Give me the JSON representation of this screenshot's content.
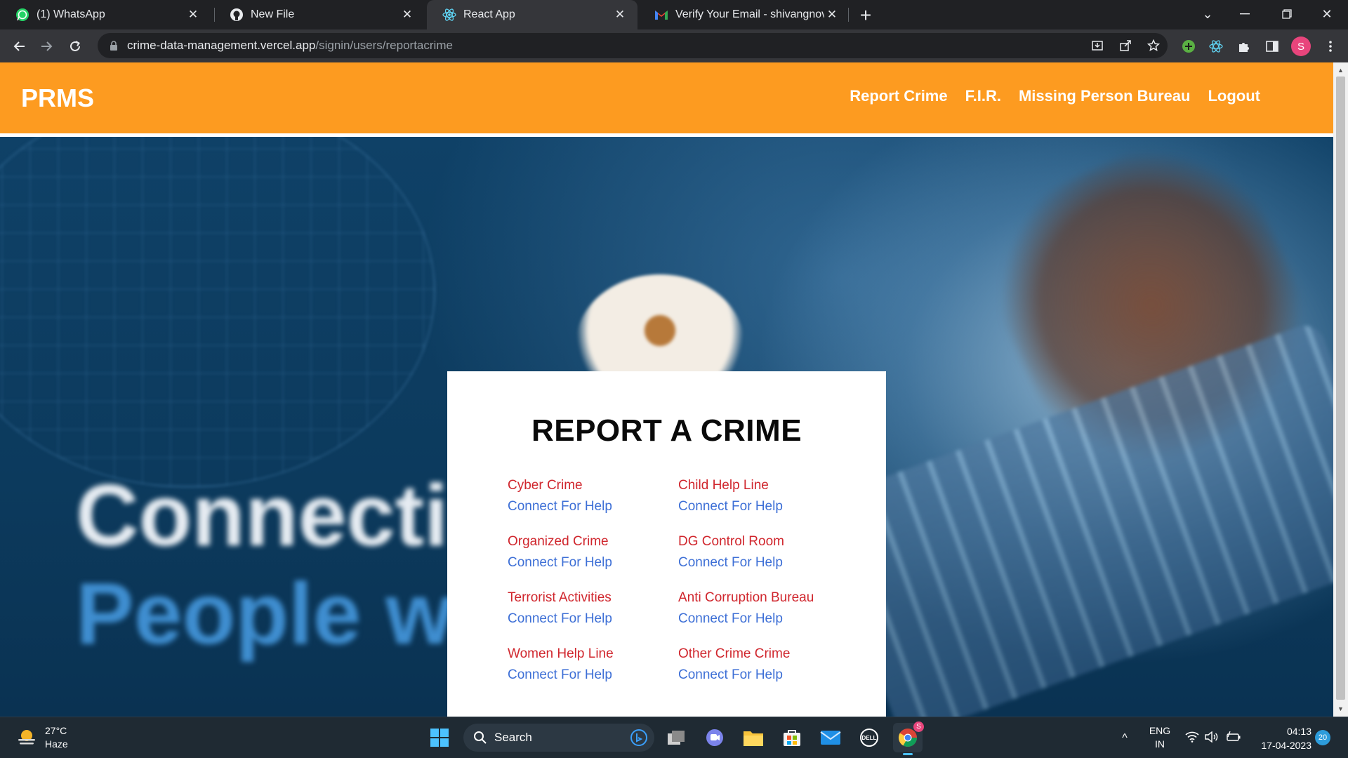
{
  "browser": {
    "tabs": [
      {
        "title": "(1) WhatsApp",
        "icon": "whatsapp-icon",
        "active": false
      },
      {
        "title": "New File",
        "icon": "github-icon",
        "active": false
      },
      {
        "title": "React App",
        "icon": "react-icon",
        "active": true
      },
      {
        "title": "Verify Your Email - shivangnov@",
        "icon": "gmail-icon",
        "active": false
      }
    ],
    "url_host": "crime-data-management.vercel.app",
    "url_path": "/signin/users/reportacrime",
    "profile_initial": "S"
  },
  "navbar": {
    "brand": "PRMS",
    "links": [
      "Report Crime",
      "F.I.R.",
      "Missing Person Bureau",
      "Logout"
    ],
    "color": "#fd9b20"
  },
  "hero": {
    "text_line1": "Connectin",
    "text_line2": "People wi"
  },
  "report": {
    "title": "REPORT A CRIME",
    "items": [
      {
        "name": "Cyber Crime",
        "link": "Connect For Help"
      },
      {
        "name": "Child Help Line",
        "link": "Connect For Help"
      },
      {
        "name": "Organized Crime",
        "link": "Connect For Help"
      },
      {
        "name": "DG Control Room",
        "link": "Connect For Help"
      },
      {
        "name": "Terrorist Activities",
        "link": "Connect For Help"
      },
      {
        "name": "Anti Corruption Bureau",
        "link": "Connect For Help"
      },
      {
        "name": "Women Help Line",
        "link": "Connect For Help"
      },
      {
        "name": "Other Crime Crime",
        "link": "Connect For Help"
      }
    ],
    "name_color": "#d0262d",
    "link_color": "#3d6fd6"
  },
  "taskbar": {
    "temperature": "27°C",
    "weather": "Haze",
    "search_label": "Search",
    "language": "ENG",
    "region": "IN",
    "time": "04:13",
    "date": "17-04-2023",
    "notifications": "20",
    "chrome_badge": "S"
  }
}
